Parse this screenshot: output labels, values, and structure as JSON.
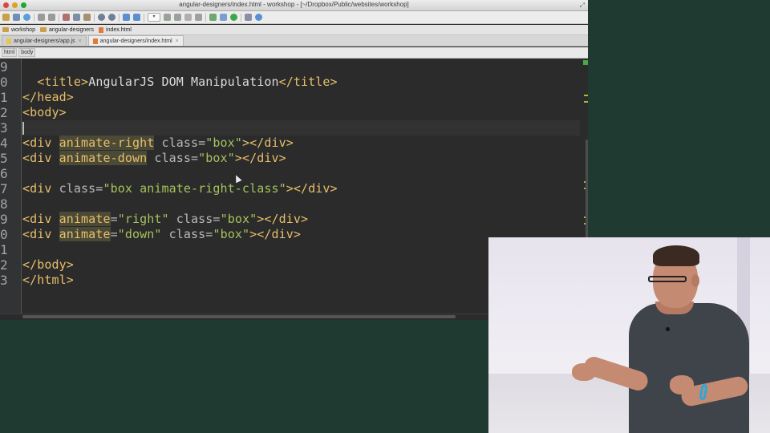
{
  "window": {
    "title": "angular-designers/index.html - workshop - [~/Dropbox/Public/websites/workshop]"
  },
  "toolbar": {
    "icons": [
      "folder-icon",
      "save-icon",
      "sync-icon",
      "back-icon",
      "forward-icon",
      "cut-icon",
      "copy-icon",
      "paste-icon",
      "find-icon",
      "replace-icon",
      "nav-back-icon",
      "nav-forward-icon",
      "run-config-dropdown",
      "run-icon",
      "debug-icon",
      "stop-icon",
      "coverage-icon",
      "build-icon",
      "vcs-icon",
      "settings-icon",
      "help-icon"
    ]
  },
  "breadcrumbs": [
    {
      "label": "workshop",
      "icon": "folder-icon"
    },
    {
      "label": "angular-designers",
      "icon": "folder-icon"
    },
    {
      "label": "index.html",
      "icon": "html-file-icon"
    }
  ],
  "tabs": [
    {
      "label": "angular-designers/app.js",
      "icon": "js-file-icon",
      "active": false
    },
    {
      "label": "angular-designers/index.html",
      "icon": "html-file-icon",
      "active": true
    }
  ],
  "tab_close_glyph": "×",
  "path_tags": [
    "html",
    "body"
  ],
  "editor": {
    "line_numbers": [
      "9",
      "0",
      "1",
      "2",
      "3",
      "4",
      "5",
      "6",
      "7",
      "8",
      "9",
      "0",
      "1",
      "2",
      "3"
    ],
    "lines": [
      {
        "segments": []
      },
      {
        "segments": [
          {
            "text": "  <title>",
            "cls": ""
          },
          {
            "text": "AngularJS DOM Manipulation",
            "cls": "txt"
          },
          {
            "text": "</title>",
            "cls": ""
          }
        ]
      },
      {
        "segments": [
          {
            "text": "</head>",
            "cls": ""
          }
        ]
      },
      {
        "segments": [
          {
            "text": "<body>",
            "cls": ""
          }
        ]
      },
      {
        "segments": []
      },
      {
        "segments": [
          {
            "text": "<div ",
            "cls": ""
          },
          {
            "text": "animate-right",
            "cls": "hl"
          },
          {
            "text": " class=",
            "cls": "attr"
          },
          {
            "text": "\"box\"",
            "cls": "str"
          },
          {
            "text": "></div>",
            "cls": ""
          }
        ]
      },
      {
        "segments": [
          {
            "text": "<div ",
            "cls": ""
          },
          {
            "text": "animate-down",
            "cls": "hl"
          },
          {
            "text": " class=",
            "cls": "attr"
          },
          {
            "text": "\"box\"",
            "cls": "str"
          },
          {
            "text": "></div>",
            "cls": ""
          }
        ]
      },
      {
        "segments": []
      },
      {
        "segments": [
          {
            "text": "<div ",
            "cls": ""
          },
          {
            "text": "class=",
            "cls": "attr"
          },
          {
            "text": "\"box animate-right-class\"",
            "cls": "str"
          },
          {
            "text": "></div>",
            "cls": ""
          }
        ]
      },
      {
        "segments": []
      },
      {
        "segments": [
          {
            "text": "<div ",
            "cls": ""
          },
          {
            "text": "animate",
            "cls": "hl"
          },
          {
            "text": "=",
            "cls": "attr"
          },
          {
            "text": "\"right\"",
            "cls": "str"
          },
          {
            "text": " class=",
            "cls": "attr"
          },
          {
            "text": "\"box\"",
            "cls": "str"
          },
          {
            "text": "></div>",
            "cls": ""
          }
        ]
      },
      {
        "segments": [
          {
            "text": "<div ",
            "cls": ""
          },
          {
            "text": "animate",
            "cls": "hl"
          },
          {
            "text": "=",
            "cls": "attr"
          },
          {
            "text": "\"down\"",
            "cls": "str"
          },
          {
            "text": " class=",
            "cls": "attr"
          },
          {
            "text": "\"box\"",
            "cls": "str"
          },
          {
            "text": "></div>",
            "cls": ""
          }
        ]
      },
      {
        "segments": []
      },
      {
        "segments": [
          {
            "text": "</body>",
            "cls": ""
          }
        ]
      },
      {
        "segments": [
          {
            "text": "</html>",
            "cls": ""
          }
        ]
      }
    ]
  },
  "colors": {
    "editor_bg": "#2b2b2b",
    "tag": "#e8bf6a",
    "attribute": "#bababa",
    "string": "#a5c25c",
    "highlight": "#4b4a36",
    "background": "#1f3a30"
  }
}
